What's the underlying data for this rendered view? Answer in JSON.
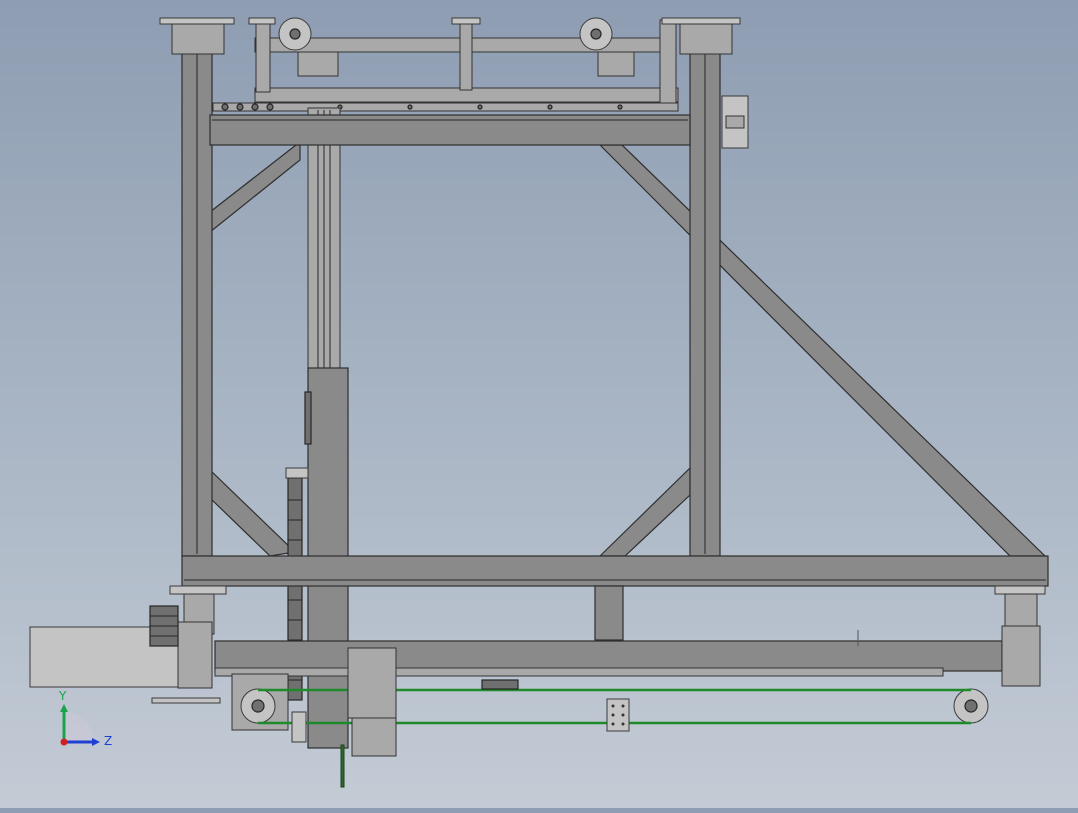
{
  "viewport": {
    "background_top": "#8e9db2",
    "background_bottom": "#c3cbd5",
    "content": "3d-gantry-frame-model-side-view"
  },
  "triad": {
    "y_label": "Y",
    "z_label": "Z",
    "y_color": "#1aa34a",
    "z_color": "#1e3fd1",
    "x_color": "#d11e1e"
  },
  "colors": {
    "steel": "#8a8a8a",
    "belt": "#1f8a2a"
  }
}
